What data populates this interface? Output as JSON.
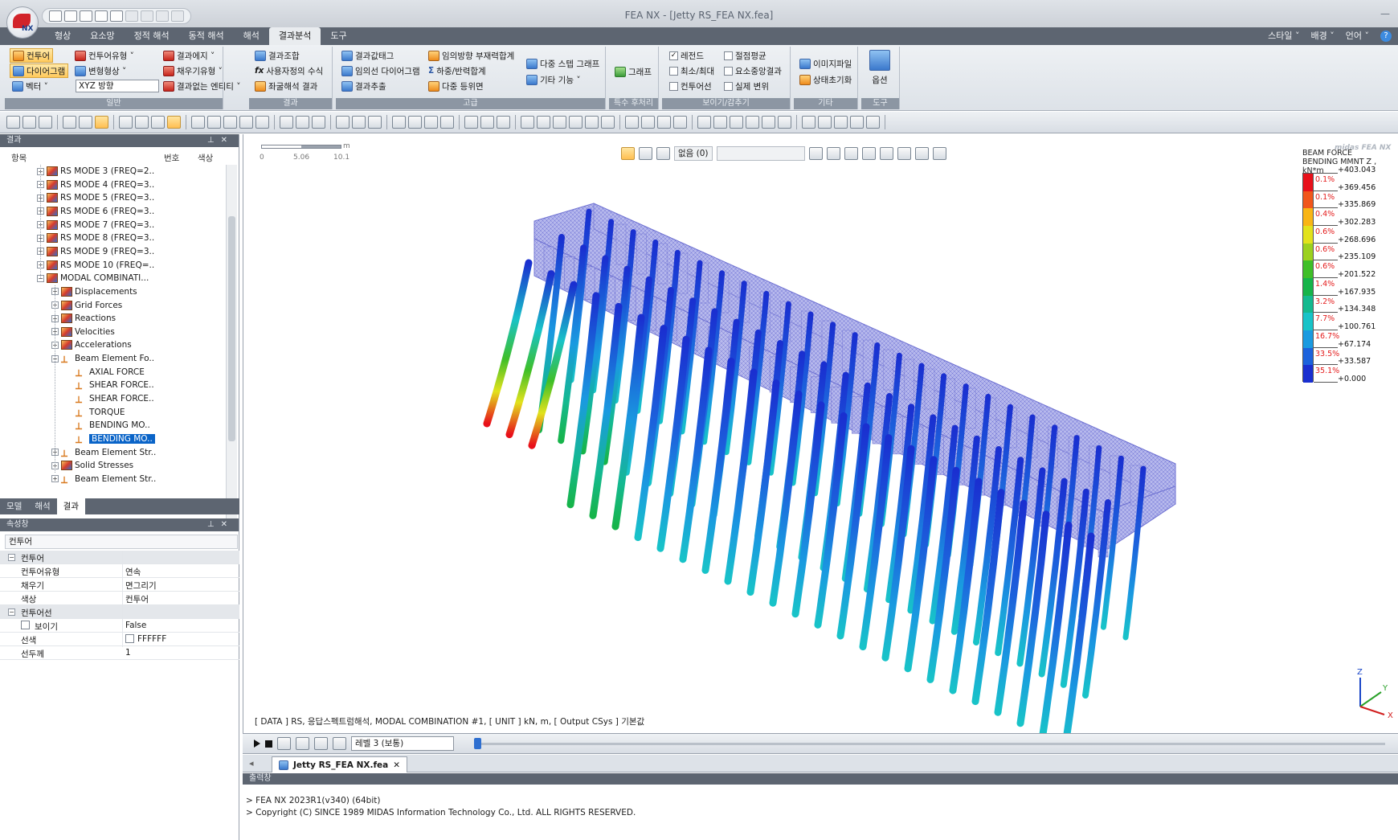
{
  "titlebar": {
    "window_title": "FEA NX - [Jetty RS_FEA NX.fea]",
    "logo_text": "NX"
  },
  "menu": {
    "tabs": [
      "형상",
      "요소망",
      "정적 해석",
      "동적 해석",
      "해석",
      "결과분석",
      "도구"
    ],
    "active_tab": "결과분석",
    "right_items": [
      "스타일 ˅",
      "배경 ˅",
      "언어 ˅"
    ]
  },
  "ribbon": {
    "general": {
      "label": "일반",
      "contour": "컨투어",
      "diagram": "다이어그램",
      "vector": "벡터 ˅",
      "contour_type": "컨투어유형 ˅",
      "deformed_shape": "변형형상 ˅",
      "direction": "XYZ 방향",
      "result_edge": "결과에지 ˅",
      "fill_type": "채우기유형 ˅",
      "no_result_entity": "결과없는 엔티티 ˅"
    },
    "result": {
      "label": "결과",
      "combination": "결과조합",
      "user_formula": "사용자정의 수식",
      "coordinate_result": "좌굴해석 결과"
    },
    "advanced": {
      "label": "고급",
      "result_tag": "결과값태그",
      "arbitrary_diagram": "임의선 다이어그램",
      "result_extract": "결과추출",
      "arbitrary_member_sum": "임의방향 부재력합계",
      "load_reaction_sum": "하중/반력합계",
      "multi_iso": "다중 등위면",
      "multi_step_graph": "다중 스텝 그래프",
      "other_functions": "기타 기능 ˅"
    },
    "special": {
      "label": "특수 후처리",
      "graph": "그래프"
    },
    "show_hide": {
      "label": "보이기/감추기",
      "legend": "레전드",
      "min_max": "최소/최대",
      "contour_line": "컨투어선",
      "node_avg": "절점평균",
      "element_center": "요소중앙결과",
      "real_displacement": "실제 변위"
    },
    "etc": {
      "label": "기타",
      "image_file": "이미지파일",
      "state_reset": "상태초기화"
    },
    "tools": {
      "label": "도구",
      "options": "옵션"
    }
  },
  "results_panel": {
    "title": "결과",
    "col_item": "항목",
    "col_number": "번호",
    "col_color": "색상",
    "tree": [
      {
        "label": "RS MODE 3 (FREQ=2..",
        "level": 2,
        "expander": "+",
        "icon": "mode"
      },
      {
        "label": "RS MODE 4 (FREQ=3..",
        "level": 2,
        "expander": "+",
        "icon": "mode"
      },
      {
        "label": "RS MODE 5 (FREQ=3..",
        "level": 2,
        "expander": "+",
        "icon": "mode"
      },
      {
        "label": "RS MODE 6 (FREQ=3..",
        "level": 2,
        "expander": "+",
        "icon": "mode"
      },
      {
        "label": "RS MODE 7 (FREQ=3..",
        "level": 2,
        "expander": "+",
        "icon": "mode"
      },
      {
        "label": "RS MODE 8 (FREQ=3..",
        "level": 2,
        "expander": "+",
        "icon": "mode"
      },
      {
        "label": "RS MODE 9 (FREQ=3..",
        "level": 2,
        "expander": "+",
        "icon": "mode"
      },
      {
        "label": "RS MODE 10 (FREQ=..",
        "level": 2,
        "expander": "+",
        "icon": "mode"
      },
      {
        "label": "MODAL COMBINATI...",
        "level": 2,
        "expander": "−",
        "icon": "mode"
      },
      {
        "label": "Displacements",
        "level": 3,
        "expander": "+",
        "icon": "result"
      },
      {
        "label": "Grid Forces",
        "level": 3,
        "expander": "+",
        "icon": "result"
      },
      {
        "label": "Reactions",
        "level": 3,
        "expander": "+",
        "icon": "result"
      },
      {
        "label": "Velocities",
        "level": 3,
        "expander": "+",
        "icon": "result"
      },
      {
        "label": "Accelerations",
        "level": 3,
        "expander": "+",
        "icon": "result"
      },
      {
        "label": "Beam Element Fo..",
        "level": 3,
        "expander": "−",
        "icon": "beam"
      },
      {
        "label": "AXIAL FORCE",
        "level": 4,
        "expander": "",
        "icon": "beam"
      },
      {
        "label": "SHEAR FORCE..",
        "level": 4,
        "expander": "",
        "icon": "beam"
      },
      {
        "label": "SHEAR FORCE..",
        "level": 4,
        "expander": "",
        "icon": "beam"
      },
      {
        "label": "TORQUE",
        "level": 4,
        "expander": "",
        "icon": "beam"
      },
      {
        "label": "BENDING MO..",
        "level": 4,
        "expander": "",
        "icon": "beam"
      },
      {
        "label": "BENDING MO..",
        "level": 4,
        "expander": "",
        "icon": "beam",
        "selected": true
      },
      {
        "label": "Beam Element Str..",
        "level": 3,
        "expander": "+",
        "icon": "beam"
      },
      {
        "label": "Solid Stresses",
        "level": 3,
        "expander": "+",
        "icon": "result"
      },
      {
        "label": "Beam Element Str..",
        "level": 3,
        "expander": "+",
        "icon": "beam"
      }
    ],
    "bottom_tabs": [
      "모델",
      "해석",
      "결과"
    ],
    "active_bottom_tab": "결과"
  },
  "props_panel": {
    "title": "속성창",
    "selector": "컨투어",
    "rows": [
      {
        "type": "section",
        "name": "컨투어"
      },
      {
        "type": "row",
        "name": "컨투어유형",
        "value": "연속"
      },
      {
        "type": "row",
        "name": "채우기",
        "value": "면그리기"
      },
      {
        "type": "row",
        "name": "색상",
        "value": "컨투어"
      },
      {
        "type": "section",
        "name": "컨투어선"
      },
      {
        "type": "check",
        "name": "보이기",
        "value": "False"
      },
      {
        "type": "color",
        "name": "선색",
        "value": "FFFFFF"
      },
      {
        "type": "row",
        "name": "선두께",
        "value": "1"
      }
    ]
  },
  "viewport": {
    "scale_unit": "m",
    "scale_ticks": [
      "0",
      "5.06",
      "10.1"
    ],
    "view_select": "없음 (0)",
    "info_line": "[ DATA ] RS,  응답스펙트럼해석, MODAL COMBINATION #1,  [ UNIT ]   kN,  m,  [ Output CSys ]  기본값",
    "axis": {
      "x": "X",
      "y": "Y",
      "z": "Z"
    }
  },
  "legend": {
    "brand": "midas FEA NX",
    "title_line1": "BEAM FORCE",
    "title_line2": "BENDING MMNT Z , kN*m",
    "values": [
      "+403.043",
      "+369.456",
      "+335.869",
      "+302.283",
      "+268.696",
      "+235.109",
      "+201.522",
      "+167.935",
      "+134.348",
      "+100.761",
      "+67.174",
      "+33.587",
      "+0.000"
    ],
    "percents": [
      "0.1%",
      "0.1%",
      "0.4%",
      "0.6%",
      "0.6%",
      "0.6%",
      "1.4%",
      "3.2%",
      "7.7%",
      "16.7%",
      "33.5%",
      "35.1%"
    ],
    "colors": [
      "#e8101a",
      "#f1561b",
      "#f9b515",
      "#e2e21c",
      "#9cd11f",
      "#3fbf28",
      "#16b44a",
      "#14b98f",
      "#18c3c8",
      "#1a9ae0",
      "#1c62dc",
      "#1a2fd0"
    ]
  },
  "animation": {
    "level_select": "레벨 3 (보통)"
  },
  "doc_tab": {
    "name": "Jetty RS_FEA NX.fea"
  },
  "output": {
    "title": "출력창",
    "lines": [
      "> FEA NX 2023R1(v340) (64bit)",
      "> Copyright (C) SINCE 1989 MIDAS Information Technology Co., Ltd. ALL RIGHTS RESERVED."
    ]
  }
}
